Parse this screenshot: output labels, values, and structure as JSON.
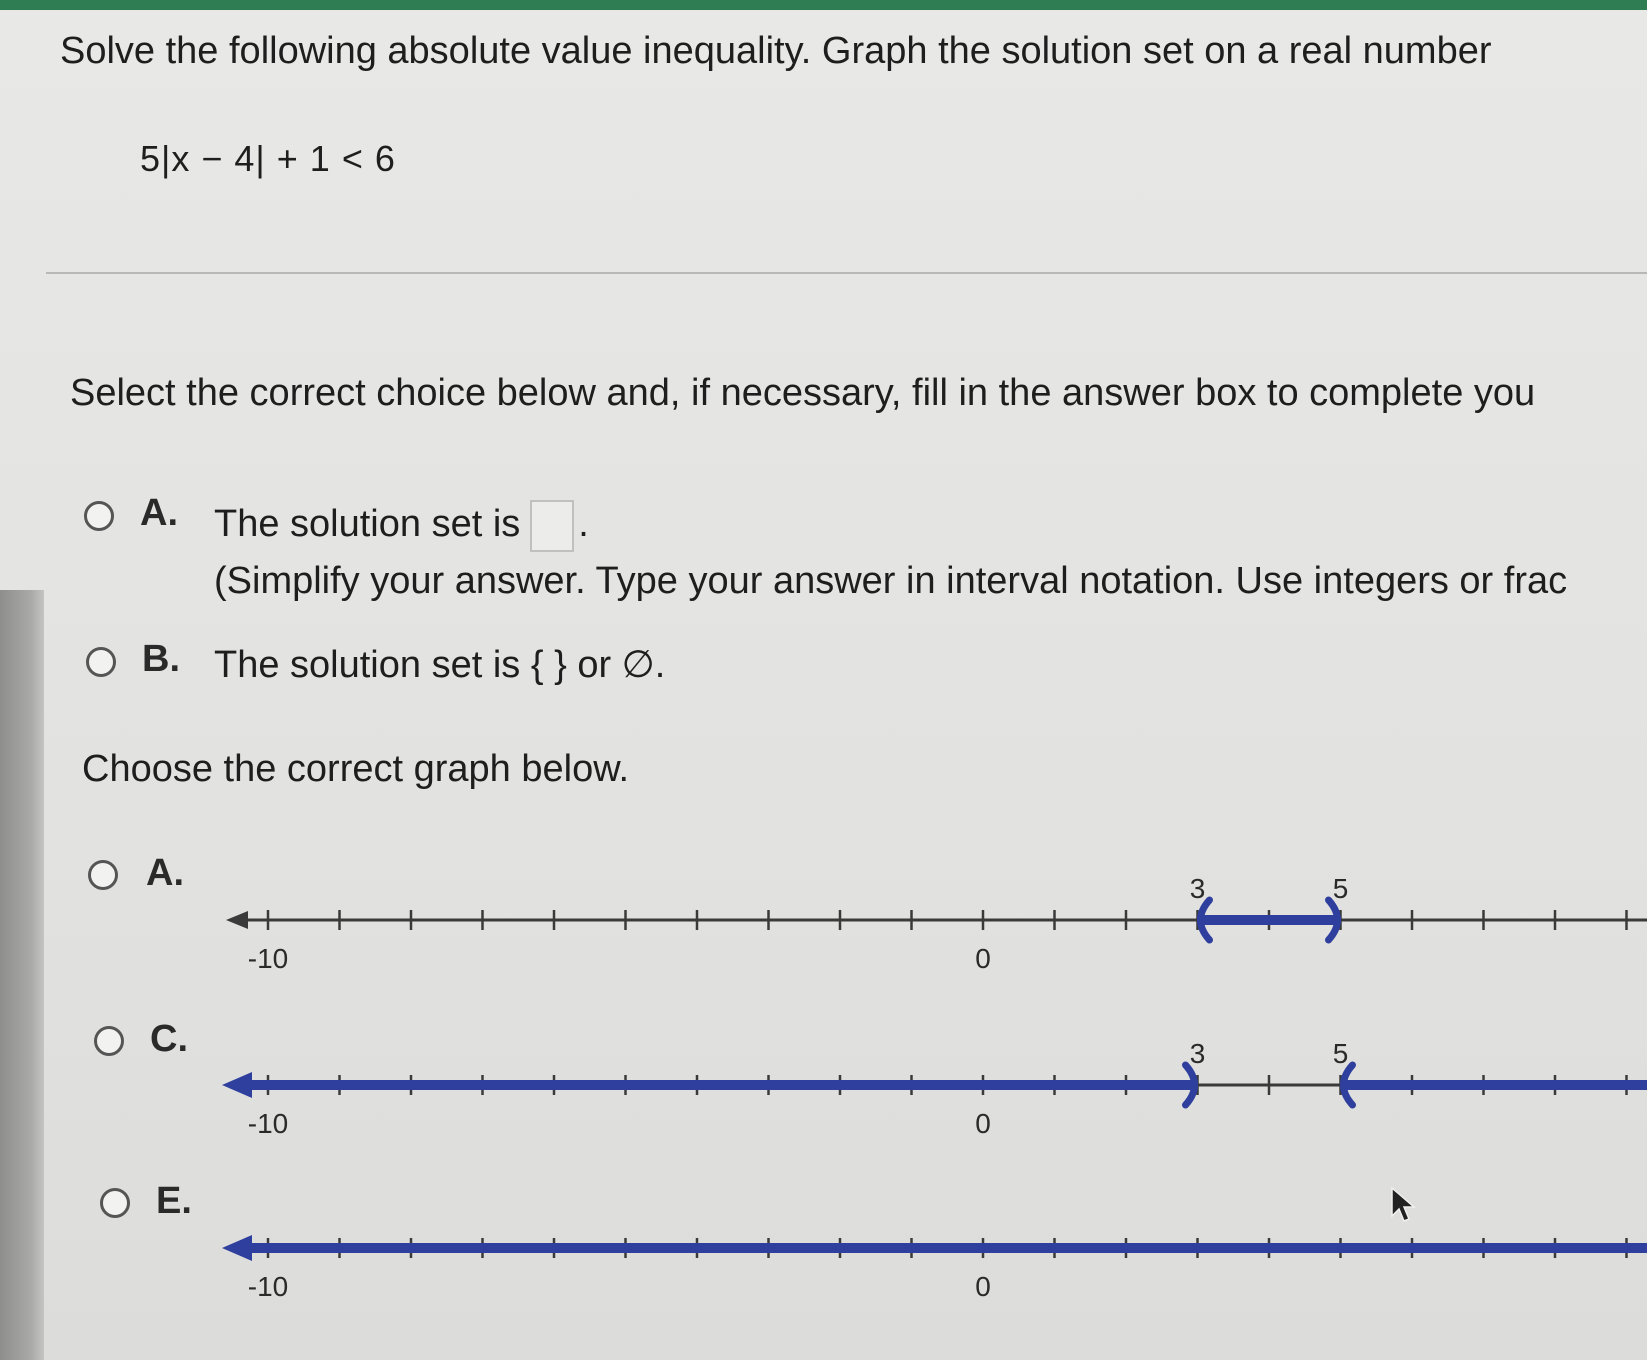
{
  "question": {
    "prompt": "Solve the following absolute value inequality. Graph the solution set on a real number",
    "equation": "5|x − 4| + 1 < 6"
  },
  "part1": {
    "instruction": "Select the correct choice below and, if necessary, fill in the answer box to complete you",
    "option_a": {
      "letter": "A.",
      "text": "The solution set is",
      "period": ".",
      "hint": "(Simplify your answer. Type your answer in interval notation. Use integers or frac"
    },
    "option_b": {
      "letter": "B.",
      "text": "The solution set is { } or ∅."
    }
  },
  "part2": {
    "instruction": "Choose the correct graph below.",
    "graphs": [
      {
        "letter": "A.",
        "range": [
          -10,
          13
        ],
        "shaded": [
          [
            3,
            5
          ]
        ],
        "endpoint_style": "open-parenthesis",
        "labels": [
          {
            "value": -10,
            "text": "-10",
            "pos": "below"
          },
          {
            "value": 0,
            "text": "0",
            "pos": "below"
          },
          {
            "value": 3,
            "text": "3",
            "pos": "above"
          },
          {
            "value": 5,
            "text": "5",
            "pos": "above"
          }
        ]
      },
      {
        "letter": "C.",
        "range": [
          -10,
          13
        ],
        "shaded": [
          [
            "-inf",
            3
          ],
          [
            5,
            "inf"
          ]
        ],
        "endpoint_style": "open-parenthesis",
        "labels": [
          {
            "value": -10,
            "text": "-10",
            "pos": "below"
          },
          {
            "value": 0,
            "text": "0",
            "pos": "below"
          },
          {
            "value": 3,
            "text": "3",
            "pos": "above"
          },
          {
            "value": 5,
            "text": "5",
            "pos": "above"
          }
        ]
      },
      {
        "letter": "E.",
        "range": [
          -10,
          13
        ],
        "shaded": [
          [
            "-inf",
            "inf"
          ]
        ],
        "endpoint_style": "none",
        "labels": [
          {
            "value": -10,
            "text": "-10",
            "pos": "below"
          },
          {
            "value": 0,
            "text": "0",
            "pos": "below"
          }
        ]
      }
    ]
  },
  "colors": {
    "shade": "#2f3f9e",
    "axis": "#3a3a3a",
    "accent_bar": "#2f7d52"
  }
}
